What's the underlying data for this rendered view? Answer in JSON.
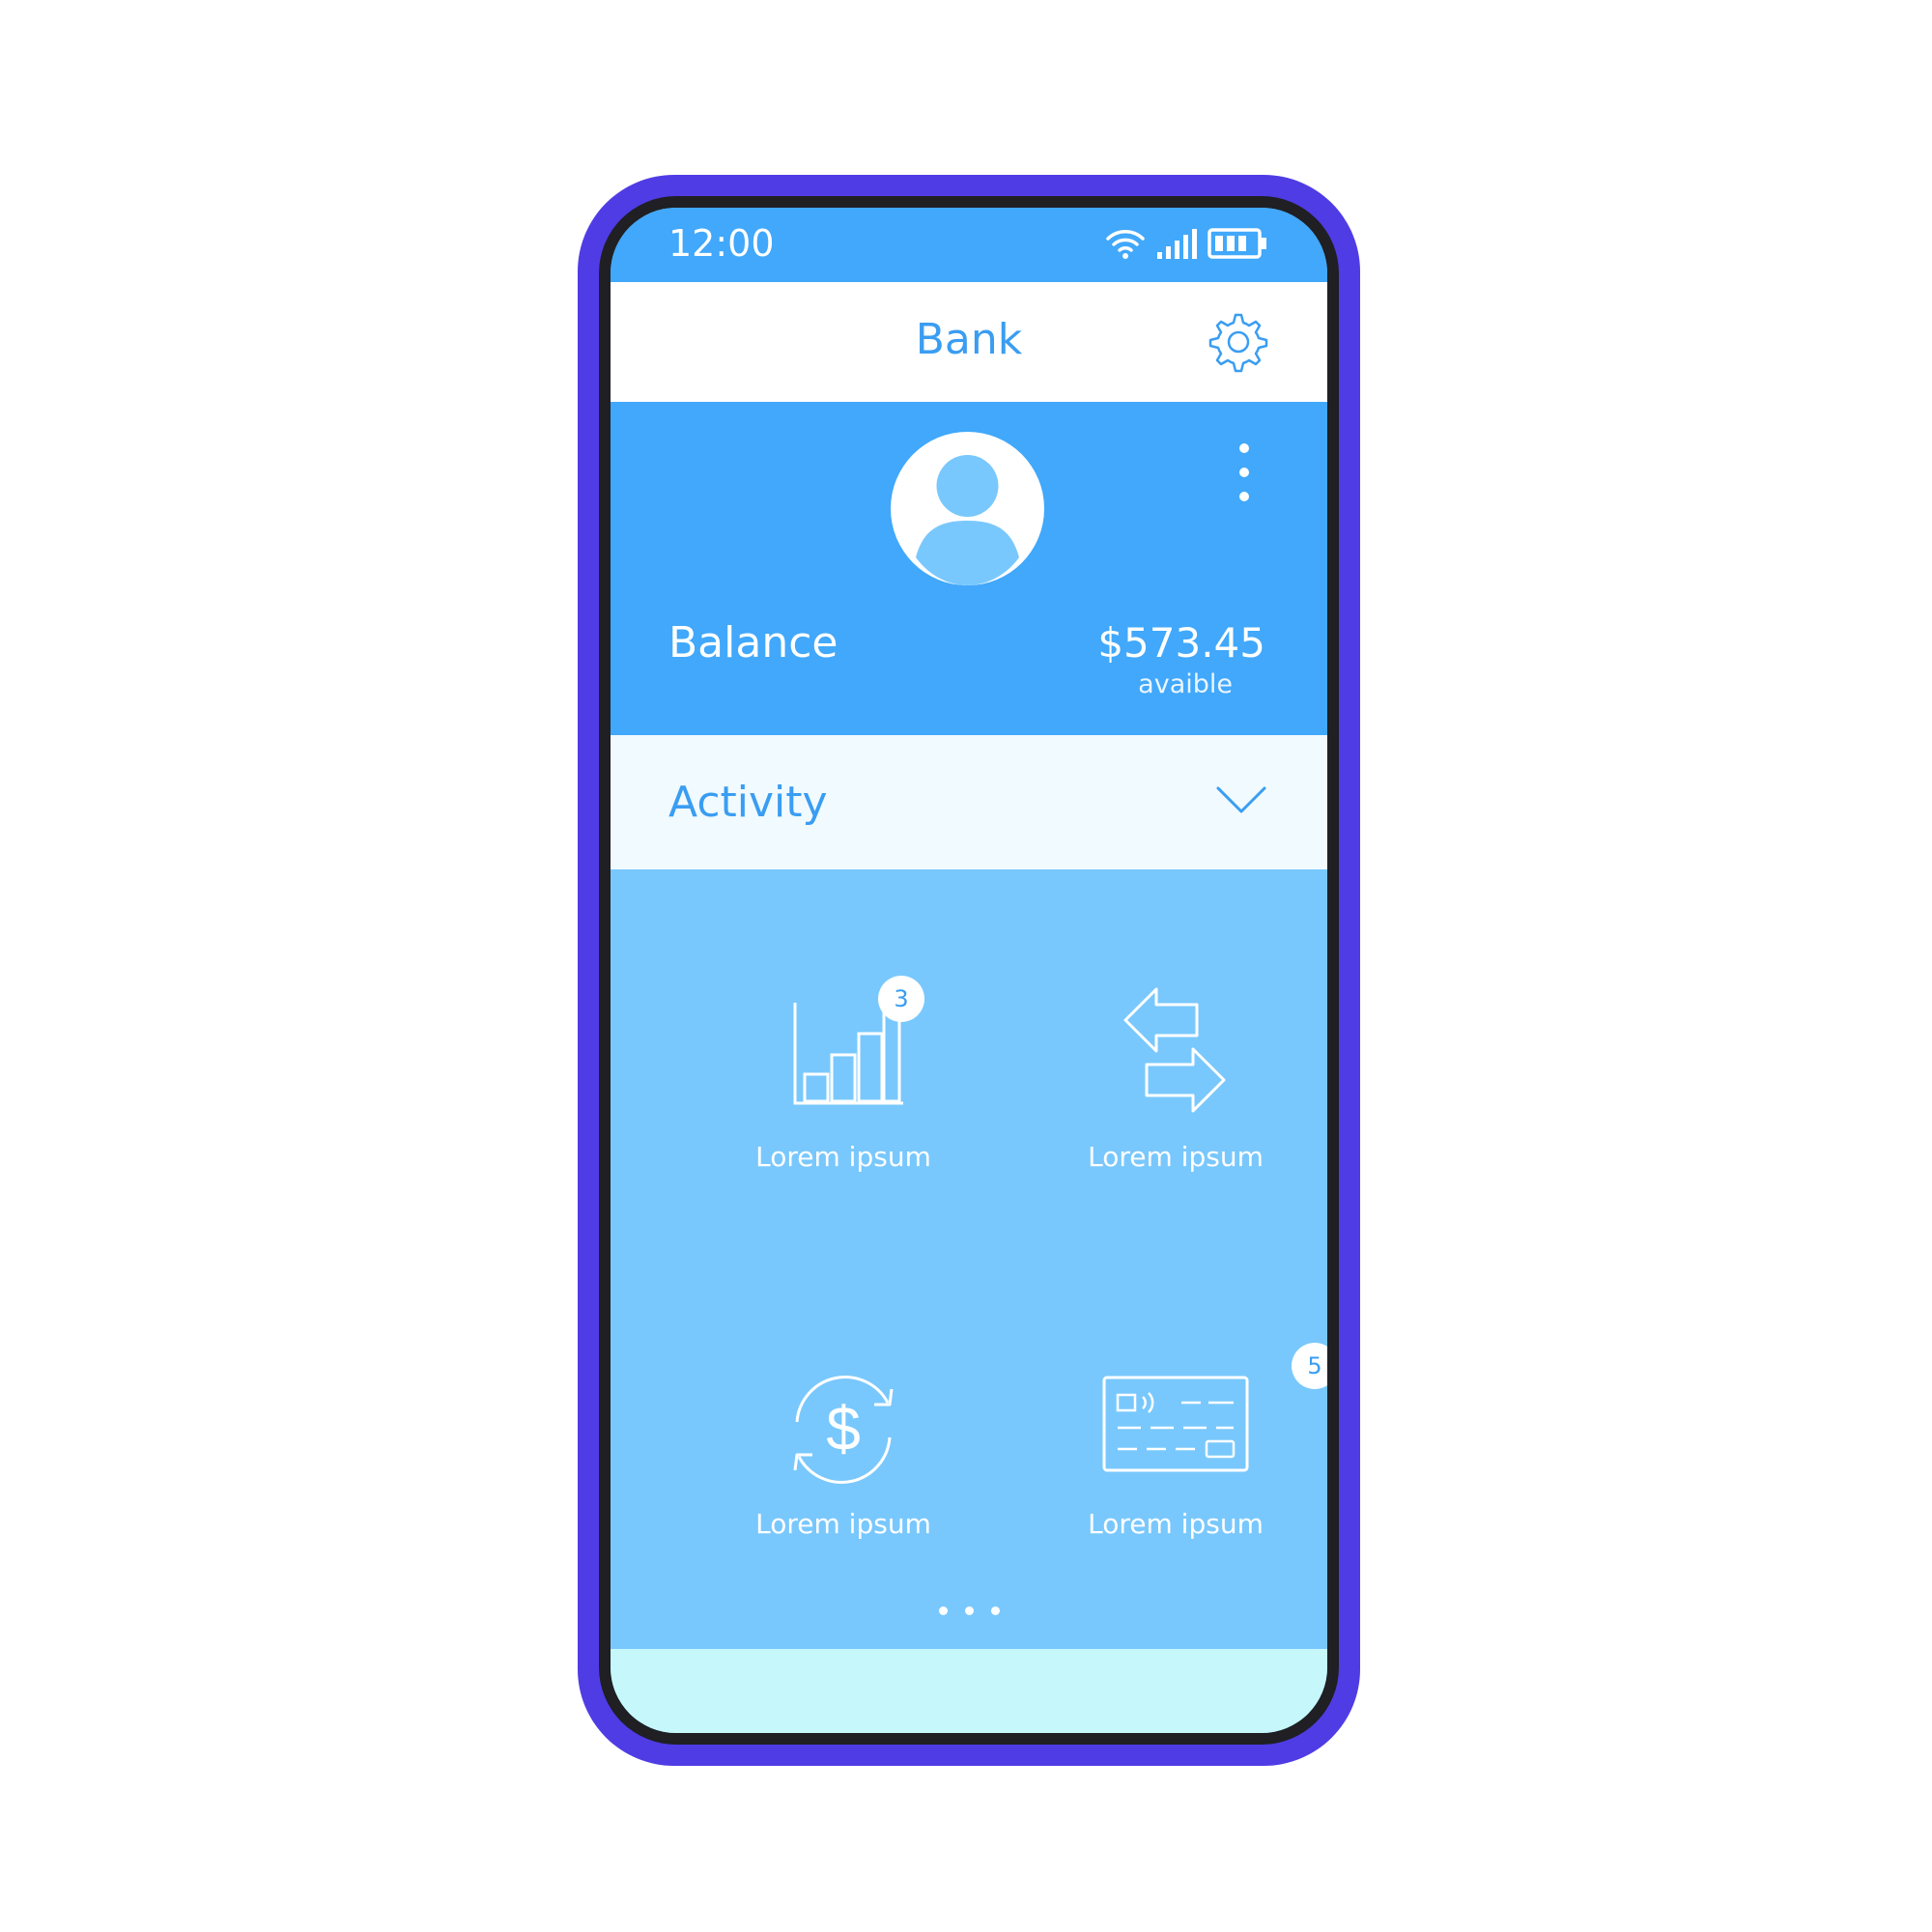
{
  "status_bar": {
    "time": "12:00"
  },
  "header": {
    "title": "Bank"
  },
  "profile": {
    "balance_label": "Balance",
    "balance_amount": "$573.45",
    "balance_sub": "avaible"
  },
  "activity": {
    "label": "Activity"
  },
  "tiles": [
    {
      "label": "Lorem ipsum",
      "icon": "bar-chart-icon",
      "badge": "3"
    },
    {
      "label": "Lorem ipsum",
      "icon": "transfer-arrows-icon",
      "badge": ""
    },
    {
      "label": "Lorem ipsum",
      "icon": "currency-exchange-icon",
      "badge": ""
    },
    {
      "label": "Lorem ipsum",
      "icon": "credit-card-icon",
      "badge": "5"
    }
  ],
  "colors": {
    "phone_frame": "#4f3ce5",
    "primary": "#41a8fb",
    "accent_text": "#3a9df2",
    "grid_bg": "#79c8fd",
    "bottom_bar": "#c6f8fb"
  }
}
